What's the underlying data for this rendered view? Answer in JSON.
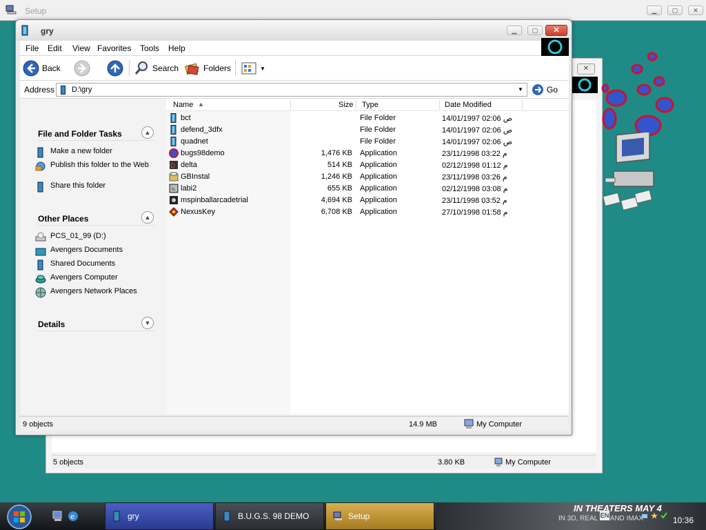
{
  "setup_window": {
    "title": "Setup"
  },
  "background_window": {
    "status_objects": "5 objects",
    "status_size": "3.80 KB",
    "status_location": "My Computer",
    "go_label": "Go"
  },
  "window": {
    "title": "gry",
    "menu": [
      "File",
      "Edit",
      "View",
      "Favorites",
      "Tools",
      "Help"
    ],
    "toolbar": {
      "back": "Back",
      "search": "Search",
      "folders": "Folders"
    },
    "address": {
      "label": "Address",
      "value": "D:\\gry",
      "go": "Go"
    },
    "tasks": {
      "file_folder_tasks": {
        "title": "File and Folder Tasks",
        "items": [
          "Make a new folder",
          "Publish this folder to the Web",
          "Share this folder"
        ]
      },
      "other_places": {
        "title": "Other Places",
        "items": [
          "PCS_01_99 (D:)",
          "Avengers Documents",
          "Shared Documents",
          "Avengers Computer",
          "Avengers Network Places"
        ]
      },
      "details": {
        "title": "Details"
      }
    },
    "columns": {
      "name": "Name",
      "size": "Size",
      "type": "Type",
      "date": "Date Modified"
    },
    "files": [
      {
        "name": "bct",
        "size": "",
        "type": "File Folder",
        "date": "14/01/1997 02:06 ص",
        "icon": "folder"
      },
      {
        "name": "defend_3dfx",
        "size": "",
        "type": "File Folder",
        "date": "14/01/1997 02:06 ص",
        "icon": "folder"
      },
      {
        "name": "quadnet",
        "size": "",
        "type": "File Folder",
        "date": "14/01/1997 02:06 ص",
        "icon": "folder"
      },
      {
        "name": "bugs98demo",
        "size": "1,476 KB",
        "type": "Application",
        "date": "23/11/1998 03:22 م",
        "icon": "app-bugs"
      },
      {
        "name": "delta",
        "size": "514 KB",
        "type": "Application",
        "date": "02/12/1998 01:12 م",
        "icon": "app-delta"
      },
      {
        "name": "GBInstal",
        "size": "1,246 KB",
        "type": "Application",
        "date": "23/11/1998 03:26 م",
        "icon": "app-installer"
      },
      {
        "name": "labi2",
        "size": "655 KB",
        "type": "Application",
        "date": "02/12/1998 03:08 م",
        "icon": "app-labi"
      },
      {
        "name": "mspinballarcadetrial",
        "size": "4,694 KB",
        "type": "Application",
        "date": "23/11/1998 03:52 م",
        "icon": "app-pinball"
      },
      {
        "name": "NexusKey",
        "size": "6,708 KB",
        "type": "Application",
        "date": "27/10/1998 01:58 م",
        "icon": "app-nexus"
      }
    ],
    "status": {
      "objects": "9 objects",
      "size": "14.9 MB",
      "location": "My Computer"
    }
  },
  "taskbar": {
    "tasks": [
      {
        "label": "gry",
        "active": true
      },
      {
        "label": "B.U.G.S. 98 DEMO",
        "active": false
      },
      {
        "label": "Setup",
        "active": false
      }
    ],
    "banner_line1": "IN THEATERS MAY 4",
    "banner_line2": "IN 3D, REAL 3D AND IMAX",
    "lang": "EN",
    "clock": "10:36"
  },
  "colors": {
    "desktop": "#1f8a86",
    "close_button": "#c8402c",
    "active_task": "#3a4fb0",
    "setup_task": "#c9a340"
  }
}
